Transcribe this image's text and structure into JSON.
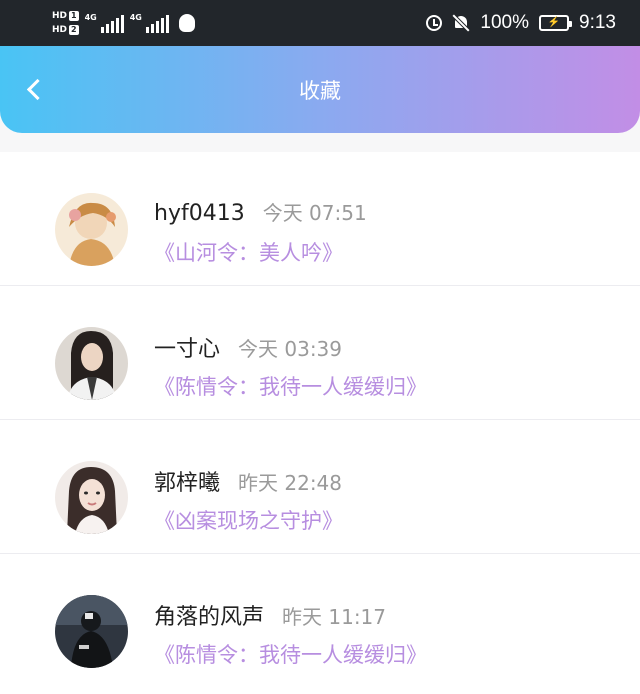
{
  "status_bar": {
    "hd1": "HD",
    "hd1_num": "1",
    "hd2": "HD",
    "hd2_num": "2",
    "net1": "4G",
    "net2": "4G",
    "battery_percent": "100%",
    "time": "9:13",
    "icons": [
      "signal-icon",
      "qq-icon",
      "alarm-icon",
      "bell-off-icon",
      "battery-charging-icon"
    ]
  },
  "header": {
    "title": "收藏",
    "back_icon": "chevron-left-icon",
    "gradient": [
      "#49c4f4",
      "#c28ee6"
    ]
  },
  "favorites": [
    {
      "user": "hyf0413",
      "time": "今天 07:51",
      "title": "《山河令：美人吟》",
      "avatar_colors": [
        "#f3e0c8",
        "#d49a5a"
      ]
    },
    {
      "user": "一寸心",
      "time": "今天 03:39",
      "title": "《陈情令：我待一人缓缓归》",
      "avatar_colors": [
        "#d9d4cf",
        "#2b2422"
      ]
    },
    {
      "user": "郭梓曦",
      "time": "昨天 22:48",
      "title": "《凶案现场之守护》",
      "avatar_colors": [
        "#efe6e4",
        "#3a2c2a"
      ]
    },
    {
      "user": "角落的风声",
      "time": "昨天 11:17",
      "title": "《陈情令：我待一人缓缓归》",
      "avatar_colors": [
        "#3b4350",
        "#111417"
      ]
    }
  ],
  "colors": {
    "accent_title": "#b78ee0",
    "timestamp": "#9a9a9a",
    "status_bar_bg": "#22262b"
  }
}
